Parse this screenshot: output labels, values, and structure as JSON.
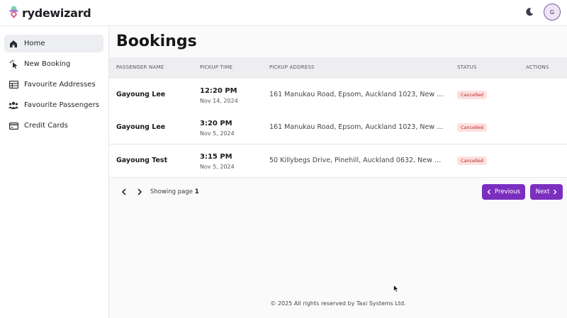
{
  "app": {
    "brand": "rydewizard",
    "avatar_initial": "G"
  },
  "sidebar": {
    "items": [
      {
        "label": "Home",
        "icon": "home-icon",
        "active": true
      },
      {
        "label": "New Booking",
        "icon": "pointer-click-icon",
        "active": false
      },
      {
        "label": "Favourite Addresses",
        "icon": "table-list-icon",
        "active": false
      },
      {
        "label": "Favourite Passengers",
        "icon": "users-icon",
        "active": false
      },
      {
        "label": "Credit Cards",
        "icon": "credit-card-icon",
        "active": false
      }
    ]
  },
  "page": {
    "title": "Bookings"
  },
  "table": {
    "columns": [
      "PASSENGER NAME",
      "PICKUP TIME",
      "PICKUP ADDRESS",
      "STATUS",
      "ACTIONS"
    ],
    "rows": [
      {
        "passenger": "Gayoung Lee",
        "time": "12:20 PM",
        "date": "Nov 14, 2024",
        "address": "161 Manukau Road, Epsom, Auckland 1023, New Ze...",
        "status": "Cancelled"
      },
      {
        "passenger": "Gayoung Lee",
        "time": "3:20 PM",
        "date": "Nov 5, 2024",
        "address": "161 Manukau Road, Epsom, Auckland 1023, New Ze...",
        "status": "Cancelled"
      },
      {
        "passenger": "Gayoung Test",
        "time": "3:15 PM",
        "date": "Nov 5, 2024",
        "address": "50 Killybegs Drive, Pinehill, Auckland 0632, New Zeal...",
        "status": "Cancelled"
      }
    ]
  },
  "pagination": {
    "showing_prefix": "Showing page",
    "page": "1",
    "previous_label": "Previous",
    "next_label": "Next"
  },
  "footer": {
    "text": "© 2025 All rights reserved by Taxi Systems Ltd."
  },
  "colors": {
    "accent": "#7b2fbf",
    "status_cancelled_bg": "#fde0e0",
    "status_cancelled_text": "#b3261e"
  }
}
